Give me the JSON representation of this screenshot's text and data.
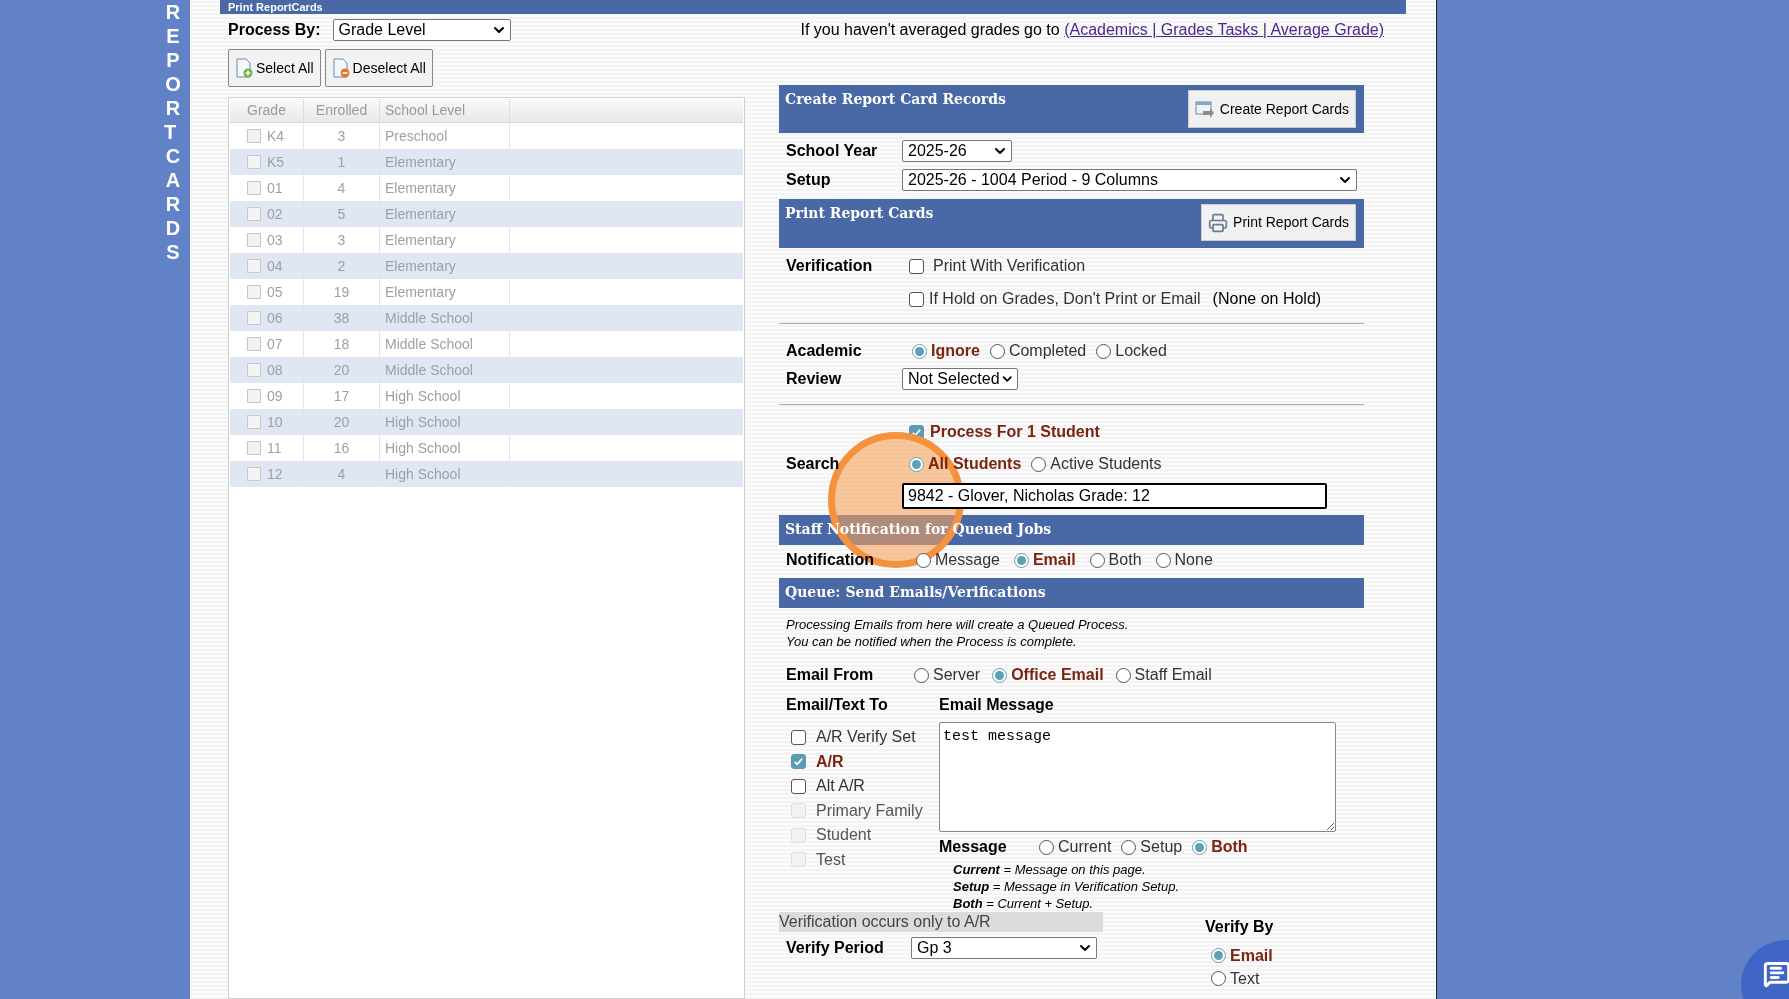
{
  "sidebar": {
    "title": "REPORT CARDS"
  },
  "page_title": "Print ReportCards",
  "process_by": {
    "label": "Process By:",
    "value": "Grade Level"
  },
  "notice": {
    "text": "If you haven't averaged grades go to",
    "link": "(Academics | Grades Tasks | Average Grade)"
  },
  "buttons": [
    {
      "label": "Select All",
      "kind": "select"
    },
    {
      "label": "Deselect All",
      "kind": "deselect"
    }
  ],
  "grade_table": {
    "columns": [
      "Grade",
      "Enrolled",
      "School Level"
    ],
    "rows": [
      {
        "grade": "K4",
        "enrolled": "3",
        "level": "Preschool",
        "checked": false
      },
      {
        "grade": "K5",
        "enrolled": "1",
        "level": "Elementary",
        "checked": false
      },
      {
        "grade": "01",
        "enrolled": "4",
        "level": "Elementary",
        "checked": false
      },
      {
        "grade": "02",
        "enrolled": "5",
        "level": "Elementary",
        "checked": false
      },
      {
        "grade": "03",
        "enrolled": "3",
        "level": "Elementary",
        "checked": false
      },
      {
        "grade": "04",
        "enrolled": "2",
        "level": "Elementary",
        "checked": false
      },
      {
        "grade": "05",
        "enrolled": "19",
        "level": "Elementary",
        "checked": false
      },
      {
        "grade": "06",
        "enrolled": "38",
        "level": "Middle School",
        "checked": false
      },
      {
        "grade": "07",
        "enrolled": "18",
        "level": "Middle School",
        "checked": false
      },
      {
        "grade": "08",
        "enrolled": "20",
        "level": "Middle School",
        "checked": false
      },
      {
        "grade": "09",
        "enrolled": "17",
        "level": "High School",
        "checked": false
      },
      {
        "grade": "10",
        "enrolled": "20",
        "level": "High School",
        "checked": false
      },
      {
        "grade": "11",
        "enrolled": "16",
        "level": "High School",
        "checked": false
      },
      {
        "grade": "12",
        "enrolled": "4",
        "level": "High School",
        "checked": false
      }
    ]
  },
  "create_section": {
    "title": "Create Report Card Records",
    "button": "Create Report Cards"
  },
  "school_year": {
    "label": "School Year",
    "value": "2025-26"
  },
  "setup": {
    "label": "Setup",
    "value": "2025-26 - 1004 Period - 9 Columns"
  },
  "print_section": {
    "title": "Print Report Cards",
    "button": "Print Report Cards"
  },
  "verification": {
    "label": "Verification",
    "options": [
      {
        "label": "Print With Verification",
        "checked": false
      },
      {
        "label": "If Hold on Grades, Don't Print or Email",
        "checked": false
      }
    ],
    "hold_note": "(None on Hold)"
  },
  "academic": {
    "label": "Academic",
    "options": [
      {
        "label": "Ignore",
        "selected": true
      },
      {
        "label": "Completed",
        "selected": false
      },
      {
        "label": "Locked",
        "selected": false
      }
    ]
  },
  "review": {
    "label": "Review",
    "value": "Not Selected"
  },
  "process_single": {
    "label": "Process For 1 Student",
    "checked": true
  },
  "search": {
    "label": "Search",
    "options": [
      {
        "label": "All Students",
        "selected": true
      },
      {
        "label": "Active Students",
        "selected": false
      }
    ],
    "value": "9842 - Glover, Nicholas Grade: 12"
  },
  "staff_notification": {
    "title": "Staff Notification for Queued Jobs",
    "label": "Notification",
    "options": [
      {
        "label": "Message",
        "selected": false
      },
      {
        "label": "Email",
        "selected": true
      },
      {
        "label": "Both",
        "selected": false
      },
      {
        "label": "None",
        "selected": false
      }
    ]
  },
  "queue": {
    "title": "Queue: Send Emails/Verifications",
    "note_lines": [
      "Processing Emails from here will create a Queued Process.",
      "You can be notified when the Process is complete."
    ]
  },
  "email_from": {
    "label": "Email From",
    "options": [
      {
        "label": "Server",
        "selected": false
      },
      {
        "label": "Office Email",
        "selected": true
      },
      {
        "label": "Staff Email",
        "selected": false
      }
    ]
  },
  "email_to": {
    "label": "Email/Text To",
    "options": [
      {
        "label": "A/R Verify Set",
        "checked": false,
        "disabled": false
      },
      {
        "label": "A/R",
        "checked": true,
        "disabled": false
      },
      {
        "label": "Alt A/R",
        "checked": false,
        "disabled": false
      },
      {
        "label": "Primary Family",
        "checked": false,
        "disabled": true
      },
      {
        "label": "Student",
        "checked": false,
        "disabled": true
      },
      {
        "label": "Test",
        "checked": false,
        "disabled": true
      }
    ]
  },
  "email_message": {
    "label": "Email Message",
    "value": "test message"
  },
  "message": {
    "label": "Message",
    "options": [
      {
        "label": "Current",
        "selected": false
      },
      {
        "label": "Setup",
        "selected": false
      },
      {
        "label": "Both",
        "selected": true
      }
    ],
    "legend": [
      "**Current** = Message on this page.",
      "**Setup** = Message in Verification Setup.",
      "**Both** = Current + Setup."
    ]
  },
  "verification_note": "Verification occurs only to A/R",
  "verify_period": {
    "label": "Verify Period",
    "value": "Gp 3"
  },
  "verify_by": {
    "label": "Verify By",
    "options": [
      {
        "label": "Email",
        "selected": true
      },
      {
        "label": "Text",
        "selected": false
      }
    ]
  }
}
